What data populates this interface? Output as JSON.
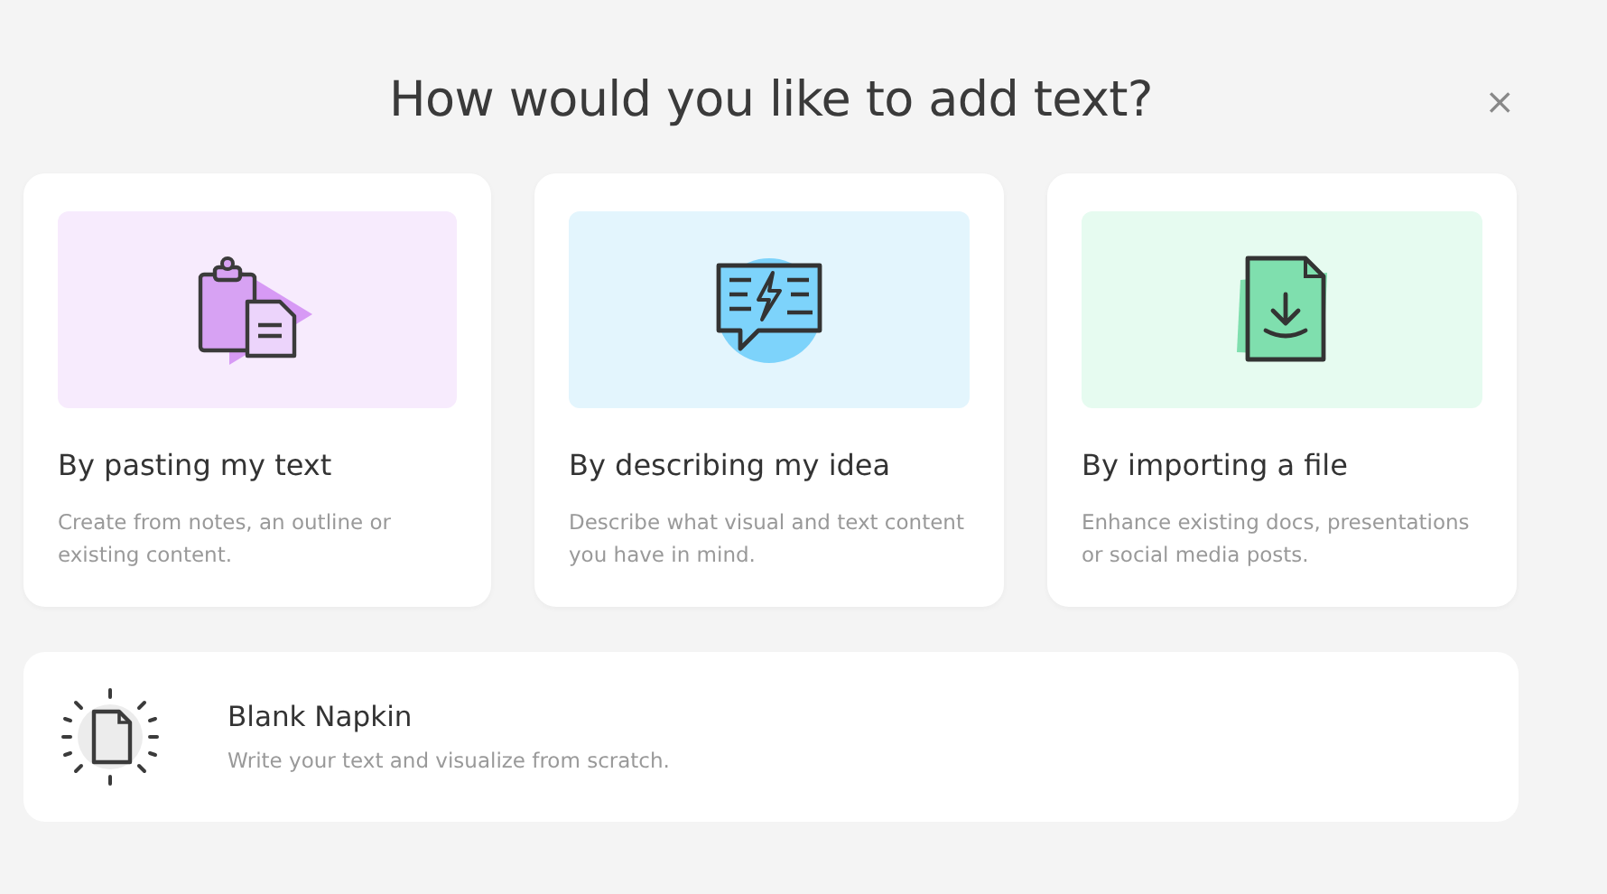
{
  "dialog": {
    "title": "How would you like to add text?",
    "close": "×"
  },
  "options": [
    {
      "kind": "paste",
      "title": "By pasting my text",
      "description": "Create from notes, an outline or existing content."
    },
    {
      "kind": "describe",
      "title": "By describing my idea",
      "description": "Describe what visual and text content you have in mind."
    },
    {
      "kind": "import",
      "title": "By importing a file",
      "description": "Enhance existing docs, presentations or social media posts."
    }
  ],
  "blank": {
    "title": "Blank Napkin",
    "description": "Write your text and visualize from scratch."
  }
}
